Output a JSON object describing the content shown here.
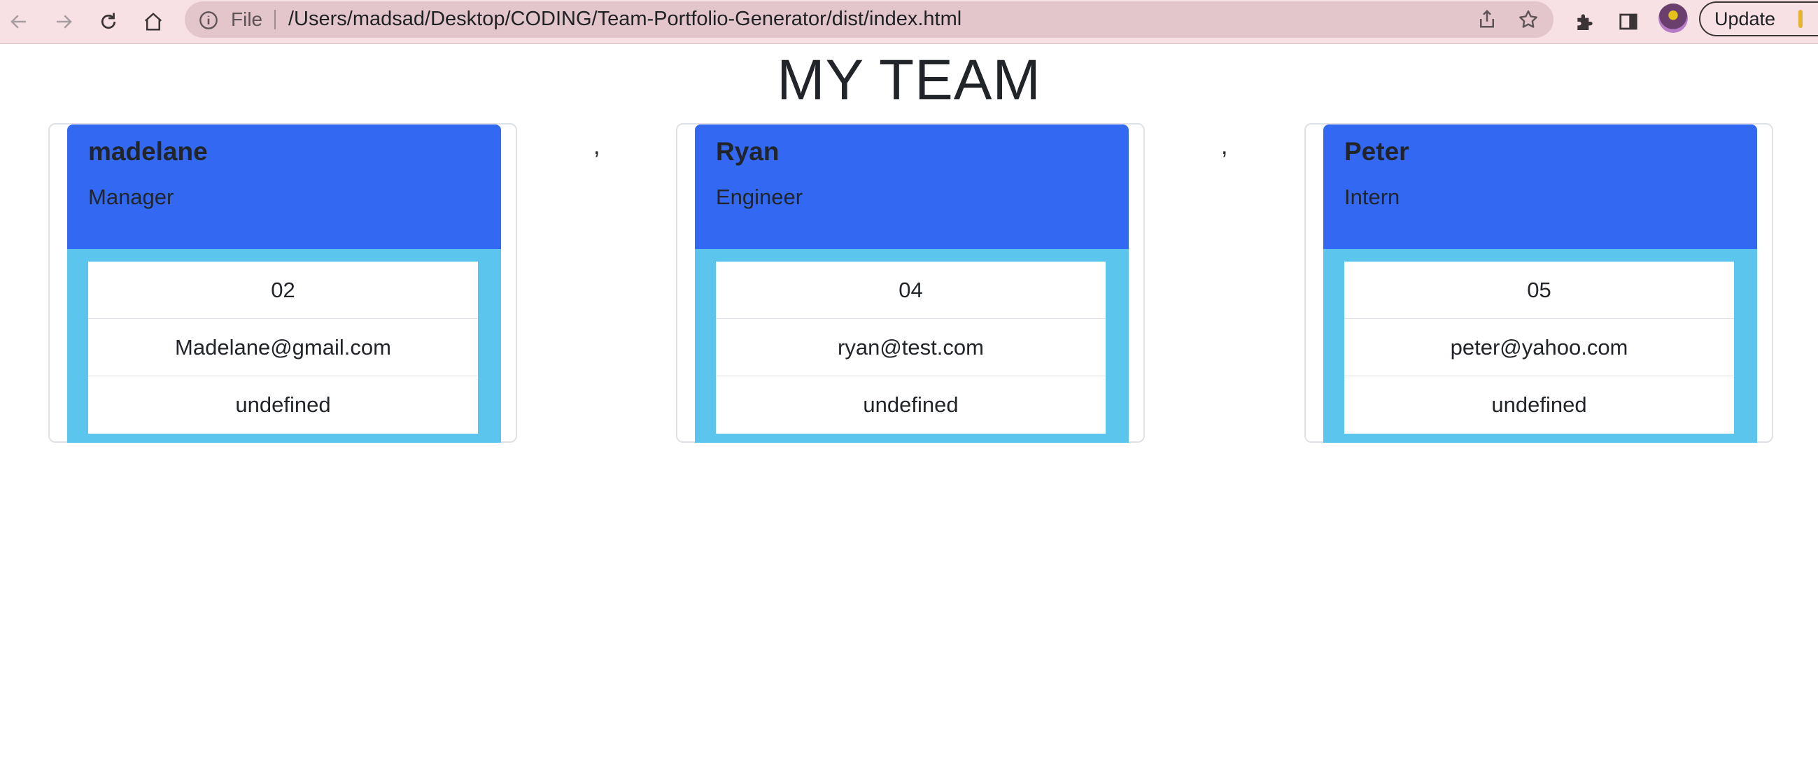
{
  "browser": {
    "file_label": "File",
    "url": "/Users/madsad/Desktop/CODING/Team-Portfolio-Generator/dist/index.html",
    "update_label": "Update",
    "icons": [
      "back-icon",
      "forward-icon",
      "reload-icon",
      "home-icon",
      "info-icon",
      "share-icon",
      "star-icon",
      "extensions-icon",
      "side-panel-icon",
      "avatar"
    ]
  },
  "page": {
    "title": "MY TEAM",
    "separator": ",",
    "colors": {
      "header": "#3369f2",
      "body": "#5bc5ee"
    }
  },
  "team": [
    {
      "name": "madelane",
      "role": "Manager",
      "id": "02",
      "email": "Madelane@gmail.com",
      "extra": "undefined"
    },
    {
      "name": "Ryan",
      "role": "Engineer",
      "id": "04",
      "email": "ryan@test.com",
      "extra": "undefined"
    },
    {
      "name": "Peter",
      "role": "Intern",
      "id": "05",
      "email": "peter@yahoo.com",
      "extra": "undefined"
    }
  ]
}
